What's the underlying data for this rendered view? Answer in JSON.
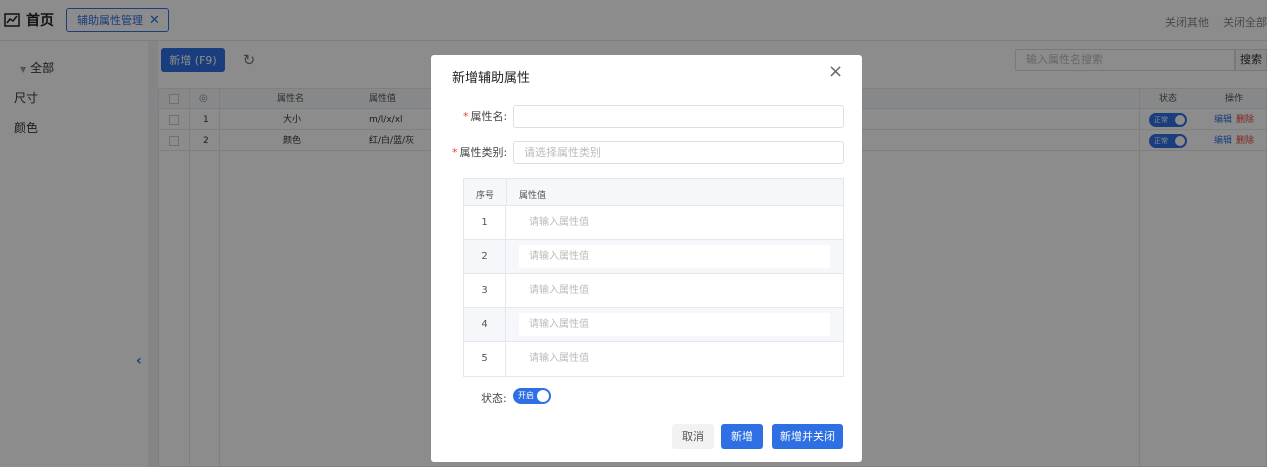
{
  "header": {
    "home_label": "首页",
    "active_tab": "辅助属性管理",
    "close_others": "关闭其他",
    "close_all": "关闭全部"
  },
  "sidebar": {
    "items": [
      "全部",
      "尺寸",
      "颜色"
    ]
  },
  "toolbar": {
    "new_label": "新增 (F9)",
    "search_placeholder": "输入属性名搜索",
    "search_label": "搜索"
  },
  "table": {
    "columns": [
      "属性名",
      "属性值",
      "状态",
      "操作"
    ],
    "rows": [
      {
        "index": "1",
        "name": "大小",
        "value": "m/l/x/xl",
        "status": "正常",
        "edit": "编辑",
        "delete": "删除"
      },
      {
        "index": "2",
        "name": "颜色",
        "value": "红/白/蓝/灰",
        "status": "正常",
        "edit": "编辑",
        "delete": "删除"
      }
    ]
  },
  "modal": {
    "title": "新增辅助属性",
    "name_label": "属性名:",
    "category_label": "属性类别:",
    "category_placeholder": "请选择属性类别",
    "value_table": {
      "col_index": "序号",
      "col_value": "属性值",
      "rows": [
        {
          "index": "1",
          "placeholder": "请输入属性值"
        },
        {
          "index": "2",
          "placeholder": "请输入属性值"
        },
        {
          "index": "3",
          "placeholder": "请输入属性值"
        },
        {
          "index": "4",
          "placeholder": "请输入属性值"
        },
        {
          "index": "5",
          "placeholder": "请输入属性值"
        }
      ]
    },
    "status_label": "状态:",
    "status_toggle": "开启",
    "cancel_label": "取消",
    "add_label": "新增",
    "add_close_label": "新增并关闭"
  }
}
